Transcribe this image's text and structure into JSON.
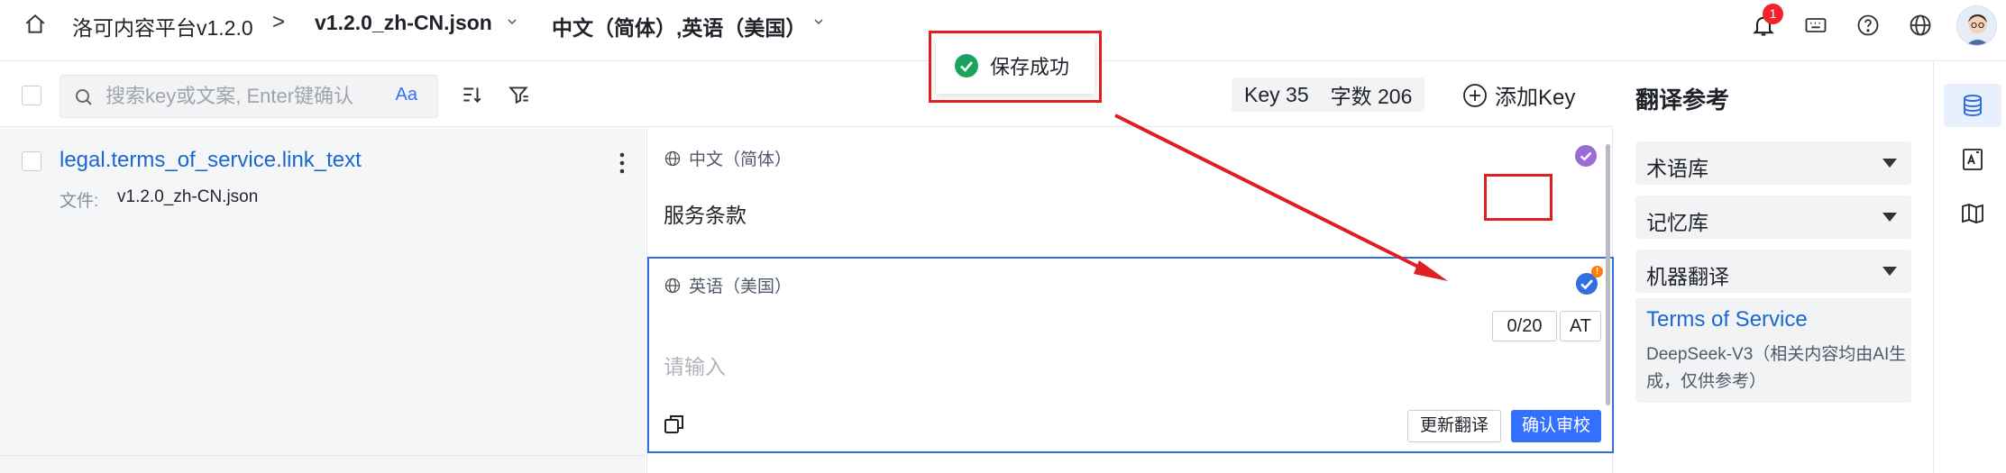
{
  "topbar": {
    "title": "洛可内容平台v1.2.0",
    "separator": ">",
    "file": "v1.2.0_zh-CN.json",
    "languages": "中文（简体）,英语（美国）",
    "notification_count": "1"
  },
  "toolbar": {
    "search_placeholder": "搜索key或文案, Enter键确认",
    "case_label": "Aa",
    "key_count": "Key 35",
    "char_count": "字数 206",
    "add_key_label": "添加Key"
  },
  "key_item": {
    "key_name": "legal.terms_of_service.link_text",
    "file_label": "文件:",
    "file_value": "v1.2.0_zh-CN.json"
  },
  "editor": {
    "source_lang": "中文（简体）",
    "source_text": "服务条款",
    "target_lang": "英语（美国）",
    "target_placeholder": "请输入",
    "counter": "0/20",
    "at_label": "AT",
    "warning_badge": "!",
    "update_button": "更新翻译",
    "confirm_button": "确认审校"
  },
  "toast": {
    "message": "保存成功"
  },
  "reference_panel": {
    "title": "翻译参考",
    "sections": [
      "术语库",
      "记忆库",
      "机器翻译"
    ],
    "mt_result": "Terms of Service",
    "mt_engine": "DeepSeek-V3（相关内容均由AI生成，仅供参考）"
  },
  "colors": {
    "accent": "#3370ff",
    "link": "#1a66d2",
    "annotation": "#e02020",
    "success": "#1aa260"
  }
}
